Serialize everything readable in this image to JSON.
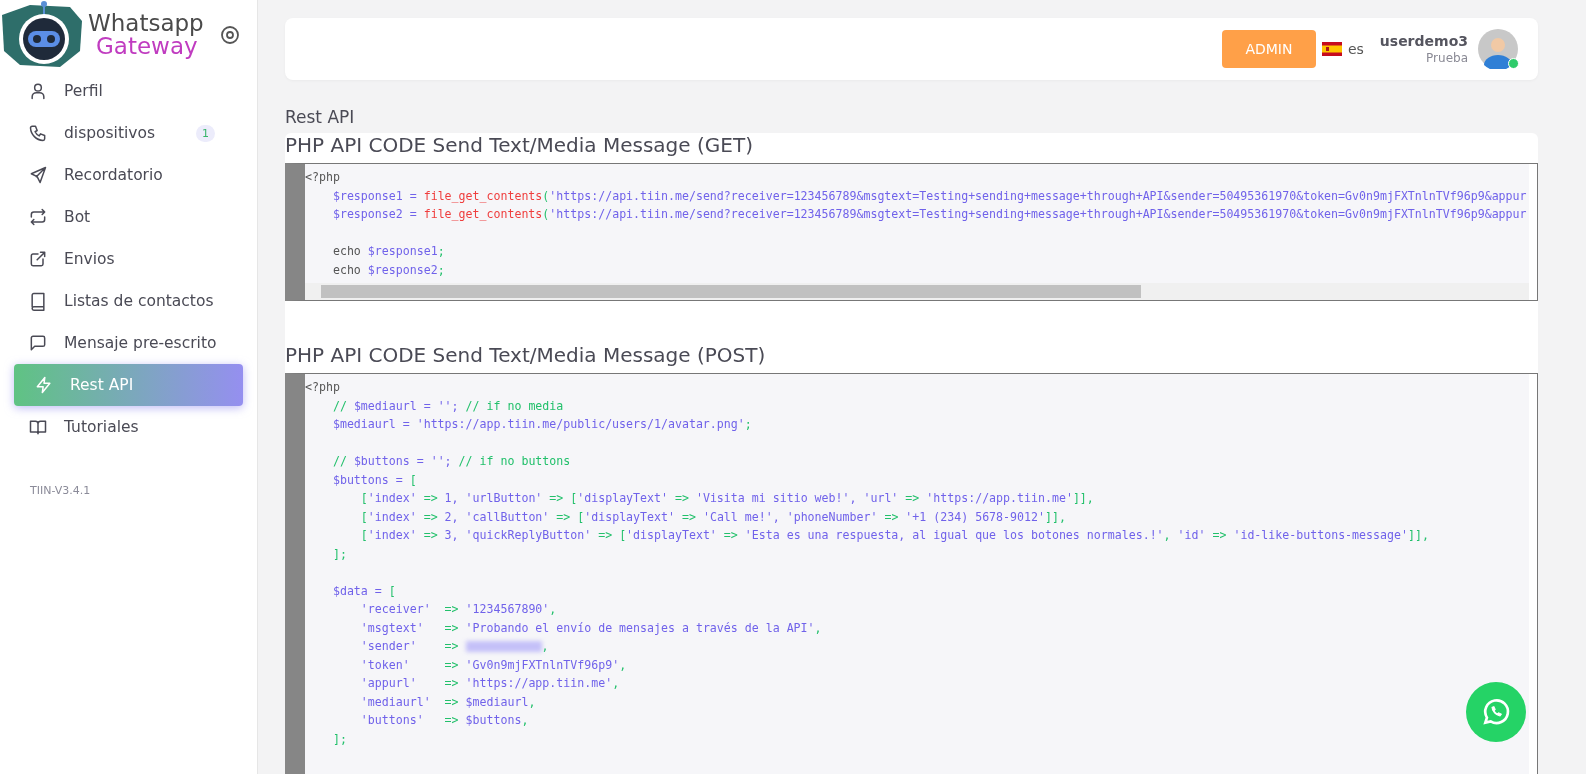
{
  "brand": {
    "line1": "Whatsapp",
    "line2": "Gateway"
  },
  "nav": [
    {
      "label": "Perfil",
      "selected": false
    },
    {
      "label": "dispositivos",
      "badge": "1",
      "selected": false
    },
    {
      "label": "Recordatorio",
      "selected": false
    },
    {
      "label": "Bot",
      "selected": false
    },
    {
      "label": "Envios",
      "selected": false
    },
    {
      "label": "Listas de contactos",
      "selected": false
    },
    {
      "label": "Mensaje pre-escrito",
      "selected": false
    },
    {
      "label": "Rest API",
      "selected": true
    },
    {
      "label": "Tutoriales",
      "selected": false
    }
  ],
  "version": "TIIN-V3.4.1",
  "header": {
    "role_button": "ADMIN",
    "language": "es",
    "user": {
      "name": "userdemo3",
      "role": "Prueba",
      "online": true
    }
  },
  "page_title": "Rest API",
  "sections": [
    {
      "title": "PHP API CODE Send Text/Media Message (GET)",
      "scrollbar": true,
      "lines": [
        [
          {
            "kind": "plain",
            "text": "<?php"
          }
        ],
        [
          {
            "kind": "var",
            "text": "    $response1 = "
          },
          {
            "kind": "func",
            "text": "file_get_contents"
          },
          {
            "kind": "punct",
            "text": "("
          },
          {
            "kind": "var",
            "text": "'https://api.tiin.me/send?receiver=123456789&msgtext=Testing+sending+message+through+API&sender=50495361970&token=Gv0n9mjFXTnlnTVf96p9&appur"
          }
        ],
        [
          {
            "kind": "var",
            "text": "    $response2 = "
          },
          {
            "kind": "func",
            "text": "file_get_contents"
          },
          {
            "kind": "punct",
            "text": "("
          },
          {
            "kind": "var",
            "text": "'https://api.tiin.me/send?receiver=123456789&msgtext=Testing+sending+message+through+API&sender=50495361970&token=Gv0n9mjFXTnlnTVf96p9&appur"
          }
        ],
        [
          {
            "kind": "blank"
          }
        ],
        [
          {
            "kind": "plain",
            "text": "    echo "
          },
          {
            "kind": "var",
            "text": "$response1"
          },
          {
            "kind": "punct",
            "text": ";"
          }
        ],
        [
          {
            "kind": "plain",
            "text": "    echo "
          },
          {
            "kind": "var",
            "text": "$response2"
          },
          {
            "kind": "punct",
            "text": ";"
          }
        ]
      ]
    },
    {
      "title": "PHP API CODE Send Text/Media Message (POST)",
      "scrollbar": false,
      "lines": [
        [
          {
            "kind": "plain",
            "text": "<?php"
          }
        ],
        [
          {
            "kind": "punct",
            "text": "    // "
          },
          {
            "kind": "var",
            "text": "$mediaurl = ''; "
          },
          {
            "kind": "punct",
            "text": "// if no media"
          }
        ],
        [
          {
            "kind": "var",
            "text": "    $mediaurl = 'https://app.tiin.me/public/users/1/avatar.png'"
          },
          {
            "kind": "punct",
            "text": ";"
          }
        ],
        [
          {
            "kind": "blank"
          }
        ],
        [
          {
            "kind": "punct",
            "text": "    // "
          },
          {
            "kind": "var",
            "text": "$buttons = ''; "
          },
          {
            "kind": "punct",
            "text": "// if no buttons"
          }
        ],
        [
          {
            "kind": "var",
            "text": "    $buttons = "
          },
          {
            "kind": "punct",
            "text": "["
          }
        ],
        [
          {
            "kind": "punct",
            "text": "        ["
          },
          {
            "kind": "var",
            "text": "'index' "
          },
          {
            "kind": "punct",
            "text": "=>"
          },
          {
            "kind": "var",
            "text": " 1, 'urlButton' "
          },
          {
            "kind": "punct",
            "text": "=> ["
          },
          {
            "kind": "var",
            "text": "'displayText' "
          },
          {
            "kind": "punct",
            "text": "=>"
          },
          {
            "kind": "var",
            "text": " 'Visita mi sitio web!', 'url' "
          },
          {
            "kind": "punct",
            "text": "=>"
          },
          {
            "kind": "var",
            "text": " 'https://app.tiin.me'"
          },
          {
            "kind": "punct",
            "text": "]],"
          }
        ],
        [
          {
            "kind": "punct",
            "text": "        ["
          },
          {
            "kind": "var",
            "text": "'index' "
          },
          {
            "kind": "punct",
            "text": "=>"
          },
          {
            "kind": "var",
            "text": " 2, 'callButton' "
          },
          {
            "kind": "punct",
            "text": "=> ["
          },
          {
            "kind": "var",
            "text": "'displayText' "
          },
          {
            "kind": "punct",
            "text": "=>"
          },
          {
            "kind": "var",
            "text": " 'Call me!', 'phoneNumber' "
          },
          {
            "kind": "punct",
            "text": "=>"
          },
          {
            "kind": "var",
            "text": " '+1 (234) 5678-9012'"
          },
          {
            "kind": "punct",
            "text": "]],"
          }
        ],
        [
          {
            "kind": "punct",
            "text": "        ["
          },
          {
            "kind": "var",
            "text": "'index' "
          },
          {
            "kind": "punct",
            "text": "=>"
          },
          {
            "kind": "var",
            "text": " 3, 'quickReplyButton' "
          },
          {
            "kind": "punct",
            "text": "=> ["
          },
          {
            "kind": "var",
            "text": "'displayText' "
          },
          {
            "kind": "punct",
            "text": "=>"
          },
          {
            "kind": "var",
            "text": " 'Esta es una respuesta, al igual que los botones normales.!'"
          },
          {
            "kind": "punct",
            "text": ", "
          },
          {
            "kind": "var",
            "text": "'id' "
          },
          {
            "kind": "punct",
            "text": "=>"
          },
          {
            "kind": "var",
            "text": " 'id-like-buttons-message'"
          },
          {
            "kind": "punct",
            "text": "]],"
          }
        ],
        [
          {
            "kind": "punct",
            "text": "    ];"
          }
        ],
        [
          {
            "kind": "blank"
          }
        ],
        [
          {
            "kind": "var",
            "text": "    $data = "
          },
          {
            "kind": "punct",
            "text": "["
          }
        ],
        [
          {
            "kind": "var",
            "text": "        'receiver'  "
          },
          {
            "kind": "punct",
            "text": "=>"
          },
          {
            "kind": "var",
            "text": " '1234567890'"
          },
          {
            "kind": "punct",
            "text": ","
          }
        ],
        [
          {
            "kind": "var",
            "text": "        'msgtext'   "
          },
          {
            "kind": "punct",
            "text": "=>"
          },
          {
            "kind": "var",
            "text": " 'Probando el envío de mensajes a través de la API'"
          },
          {
            "kind": "punct",
            "text": ","
          }
        ],
        [
          {
            "kind": "var",
            "text": "        'sender'    "
          },
          {
            "kind": "punct",
            "text": "=> "
          },
          {
            "kind": "redacted"
          },
          {
            "kind": "punct",
            "text": ","
          }
        ],
        [
          {
            "kind": "var",
            "text": "        'token'     "
          },
          {
            "kind": "punct",
            "text": "=>"
          },
          {
            "kind": "var",
            "text": " 'Gv0n9mjFXTnlnTVf96p9'"
          },
          {
            "kind": "punct",
            "text": ","
          }
        ],
        [
          {
            "kind": "var",
            "text": "        'appurl'    "
          },
          {
            "kind": "punct",
            "text": "=>"
          },
          {
            "kind": "var",
            "text": " 'https://app.tiin.me'"
          },
          {
            "kind": "punct",
            "text": ","
          }
        ],
        [
          {
            "kind": "var",
            "text": "        'mediaurl'  "
          },
          {
            "kind": "punct",
            "text": "=>"
          },
          {
            "kind": "var",
            "text": " $mediaurl"
          },
          {
            "kind": "punct",
            "text": ","
          }
        ],
        [
          {
            "kind": "var",
            "text": "        'buttons'   "
          },
          {
            "kind": "punct",
            "text": "=>"
          },
          {
            "kind": "var",
            "text": " $buttons"
          },
          {
            "kind": "punct",
            "text": ","
          }
        ],
        [
          {
            "kind": "punct",
            "text": "    ];"
          }
        ]
      ]
    }
  ]
}
